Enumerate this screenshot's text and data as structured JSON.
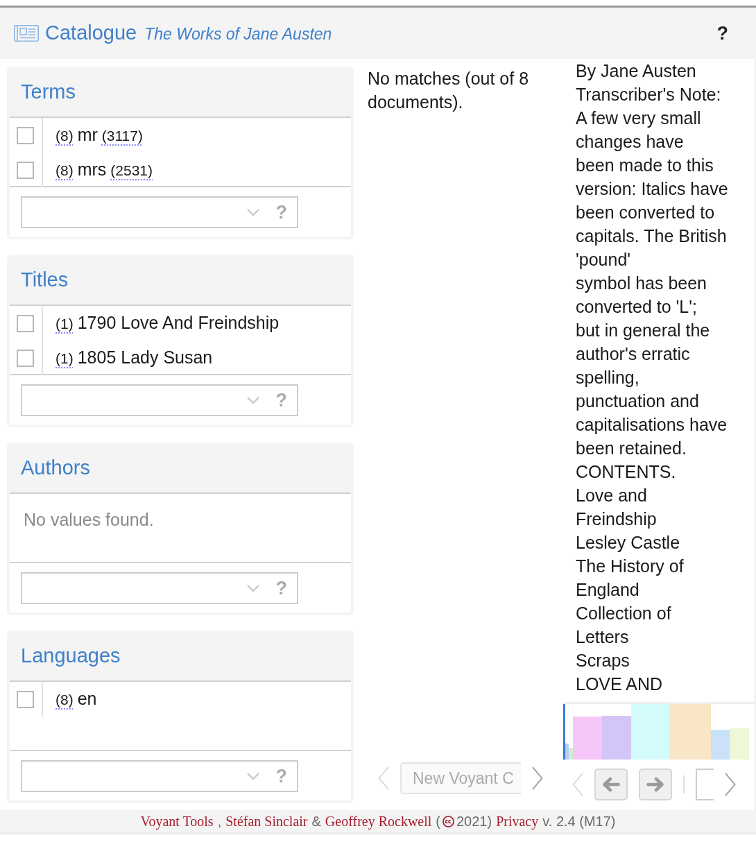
{
  "header": {
    "title": "Catalogue",
    "subtitle": "The Works of Jane Austen",
    "help": "?"
  },
  "facets": [
    {
      "title": "Terms",
      "items": [
        {
          "checked": false,
          "documents": "(8)",
          "label": "mr",
          "count": "(3117)"
        },
        {
          "checked": false,
          "documents": "(8)",
          "label": "mrs",
          "count": "(2531)"
        }
      ],
      "help": "?"
    },
    {
      "title": "Titles",
      "items": [
        {
          "checked": false,
          "documents": "(1)",
          "label": "1790 Love And Freindship"
        },
        {
          "checked": false,
          "documents": "(1)",
          "label": "1805 Lady Susan"
        }
      ],
      "help": "?"
    },
    {
      "title": "Authors",
      "message": "No values found.",
      "help": "?"
    },
    {
      "title": "Languages",
      "items": [
        {
          "checked": false,
          "documents": "(8)",
          "label": "en"
        }
      ],
      "help": "?"
    }
  ],
  "results": {
    "message": "No matches (out of 8 documents).",
    "toolbar": {
      "scroll_left": {
        "disabled": true
      },
      "document_button": "New Voyant C",
      "scroll_right": {
        "disabled": false
      }
    }
  },
  "reader": {
    "lines": [
      "By Jane Austen",
      "Transcriber's Note:",
      "A few very small",
      "changes have",
      "been made to this",
      "version: Italics have",
      "been converted to",
      "capitals. The British",
      "'pound'",
      "symbol has been",
      "converted to 'L';",
      "but in general the",
      "author's erratic",
      "spelling,",
      "punctuation and",
      "capitalisations have",
      "been retained.",
      "CONTENTS.",
      "Love and",
      "Freindship",
      "Lesley Castle",
      "The History of",
      "England",
      "Collection of",
      "Letters",
      "Scraps",
      "LOVE AND"
    ],
    "toolbar": {
      "scroll_left": {
        "disabled": true
      },
      "scroll_right": {
        "disabled": false
      }
    }
  },
  "footer": {
    "parts": [
      {
        "kind": "link",
        "text": "Voyant Tools"
      },
      {
        "kind": "text",
        "text": ","
      },
      {
        "kind": "link",
        "text": "Stéfan Sinclair"
      },
      {
        "kind": "text",
        "text": "&"
      },
      {
        "kind": "link",
        "text": "Geoffrey Rockwell"
      },
      {
        "kind": "text",
        "text": "("
      },
      {
        "kind": "icon"
      },
      {
        "kind": "text",
        "text": "2021)"
      },
      {
        "kind": "link",
        "text": "Privacy"
      },
      {
        "kind": "text",
        "text": "v. 2.4 (M17)"
      }
    ]
  }
}
